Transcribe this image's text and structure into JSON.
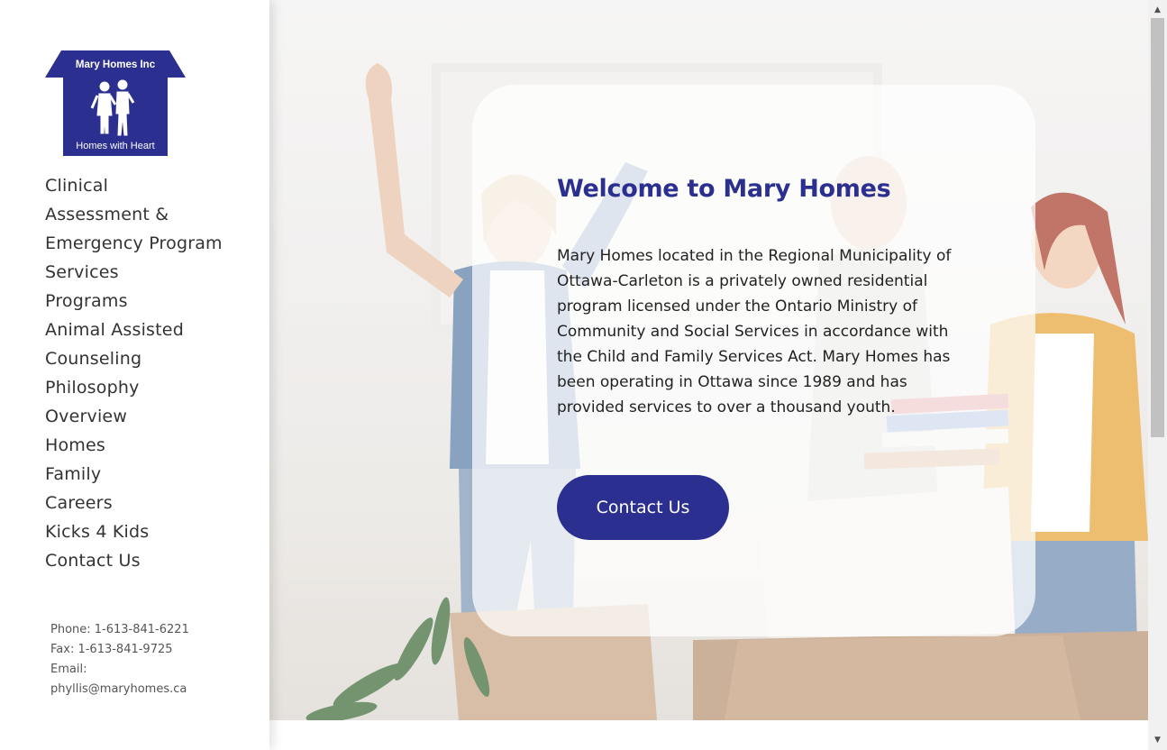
{
  "brand": {
    "logo_top_text": "Mary Homes Inc",
    "logo_bottom_text": "Homes with Heart",
    "logo_color": "#2b2f8f"
  },
  "nav": {
    "items": [
      "Clinical",
      "Assessment &",
      "Emergency Program",
      "Services",
      "Programs",
      "Animal Assisted",
      "Counseling",
      "Philosophy",
      "Overview",
      "Homes",
      "Family",
      "Careers",
      "Kicks 4 Kids",
      "Contact Us"
    ]
  },
  "contact": {
    "phone": "Phone: 1-613-841-6221",
    "fax": "Fax: 1-613-841-9725",
    "email_label": "Email:",
    "email": "phyllis@maryhomes.ca"
  },
  "hero": {
    "title": "Welcome to Mary Homes",
    "body": "Mary Homes located in the Regional Municipality of Ottawa-Carleton is a privately owned residential program licensed under the Ontario Ministry of Community and Social Services in accordance with the Child and Family Services Act. Mary Homes has been operating in Ottawa since 1989 and has provided services to over a thousand youth.",
    "cta_label": "Contact Us"
  },
  "colors": {
    "accent": "#2b2f8f",
    "text": "#222222",
    "nav_text": "#333333"
  },
  "scrollbar": {
    "up_icon": "▲",
    "down_icon": "▼"
  }
}
